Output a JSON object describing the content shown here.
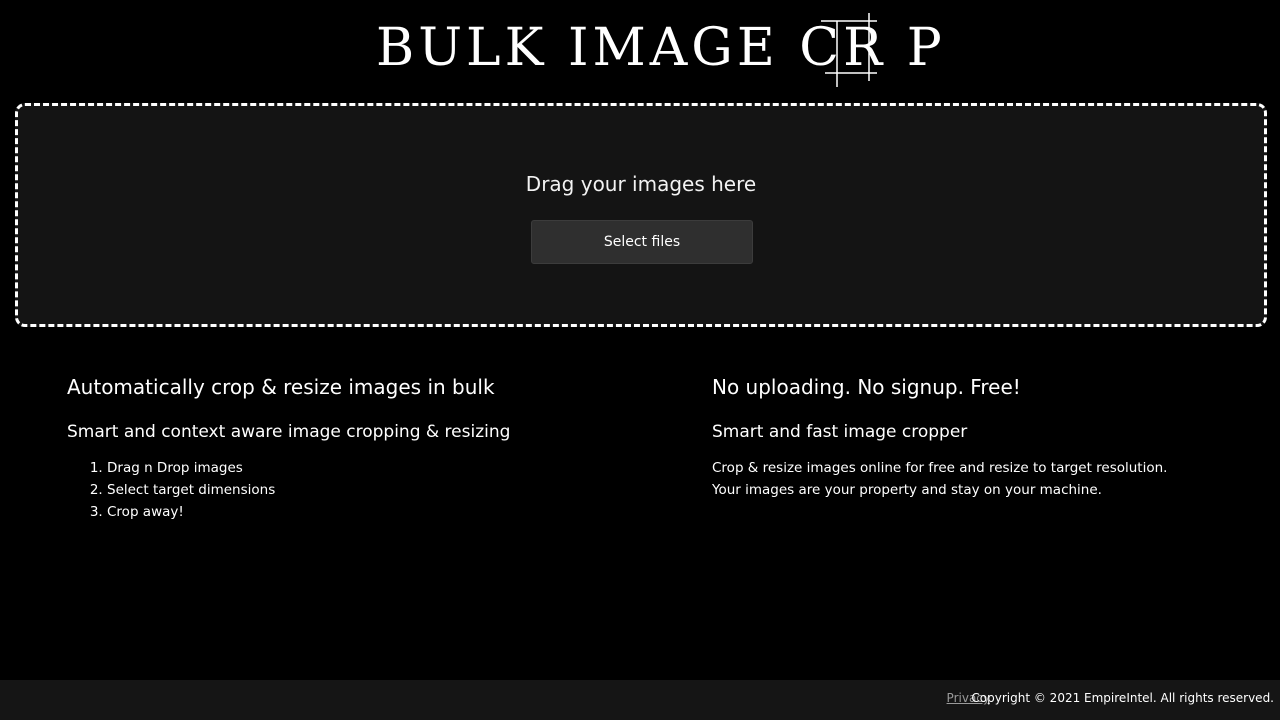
{
  "header": {
    "logo_text": "BULK IMAGE CR P"
  },
  "dropzone": {
    "title": "Drag your images here",
    "button_label": "Select files"
  },
  "left_column": {
    "heading": "Automatically crop & resize images in bulk",
    "subheading": "Smart and context aware image cropping & resizing",
    "steps": [
      "Drag n Drop images",
      "Select target dimensions",
      "Crop away!"
    ]
  },
  "right_column": {
    "heading": "No uploading. No signup. Free!",
    "subheading": "Smart and fast image cropper",
    "description": "Crop & resize images online for free and resize to target resolution. Your images are your property and stay on your machine."
  },
  "footer": {
    "privacy_label": "Privacy",
    "copyright": "Copyright © 2021 EmpireIntel. All rights reserved."
  },
  "colors": {
    "background": "#000000",
    "dropzone_background": "#141414",
    "button_background": "#2f2f2f",
    "footer_background": "#151515",
    "privacy_link": "#9a9a9a"
  }
}
